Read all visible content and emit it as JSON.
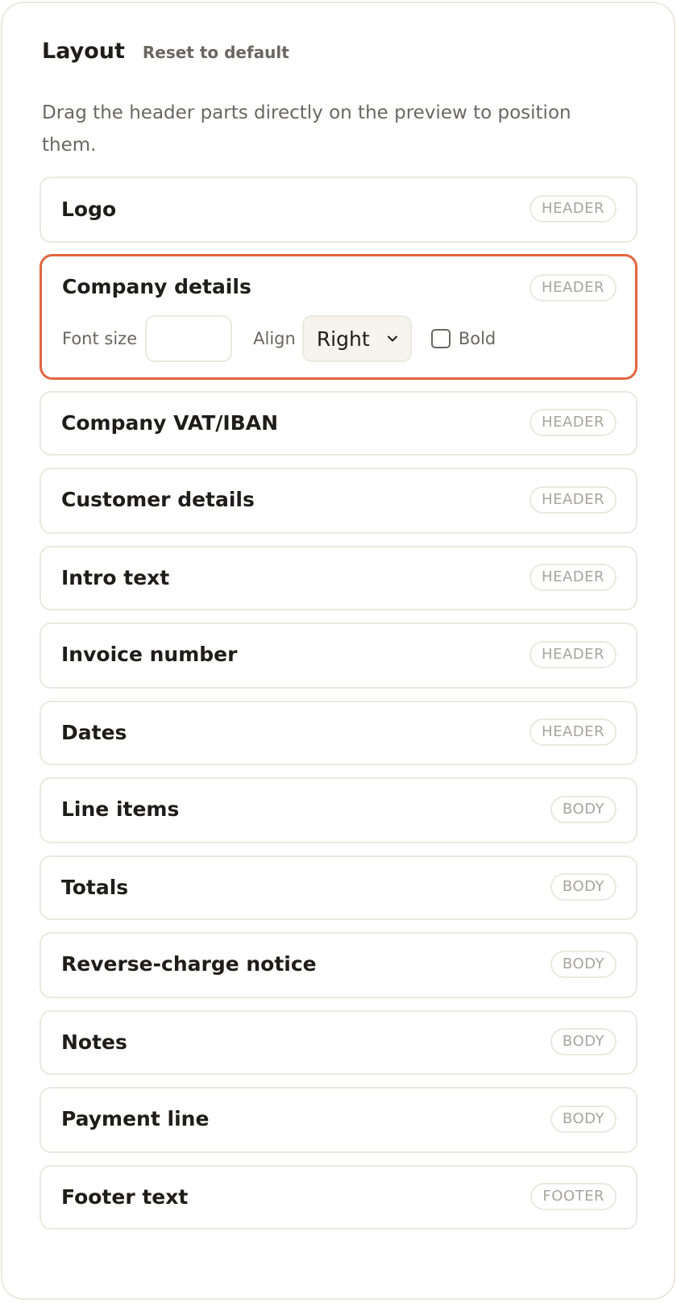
{
  "layout": {
    "title": "Layout",
    "reset_label": "Reset to default",
    "description": "Drag the header parts directly on the preview to position them."
  },
  "items": [
    {
      "label": "Logo",
      "tag": "HEADER"
    },
    {
      "label": "Company details",
      "tag": "HEADER",
      "selected": true
    },
    {
      "label": "Company VAT/IBAN",
      "tag": "HEADER"
    },
    {
      "label": "Customer details",
      "tag": "HEADER"
    },
    {
      "label": "Intro text",
      "tag": "HEADER"
    },
    {
      "label": "Invoice number",
      "tag": "HEADER"
    },
    {
      "label": "Dates",
      "tag": "HEADER"
    },
    {
      "label": "Line items",
      "tag": "BODY"
    },
    {
      "label": "Totals",
      "tag": "BODY"
    },
    {
      "label": "Reverse-charge notice",
      "tag": "BODY"
    },
    {
      "label": "Notes",
      "tag": "BODY"
    },
    {
      "label": "Payment line",
      "tag": "BODY"
    },
    {
      "label": "Footer text",
      "tag": "FOOTER"
    }
  ],
  "controls": {
    "font_size_label": "Font size",
    "font_size_value": "",
    "align_label": "Align",
    "align_value": "Right",
    "bold_label": "Bold",
    "bold_checked": false
  },
  "colors": {
    "accent": "#e2663f",
    "border": "#ebe8df",
    "muted_text": "#6b6660",
    "tag_text": "#a9a49c"
  }
}
